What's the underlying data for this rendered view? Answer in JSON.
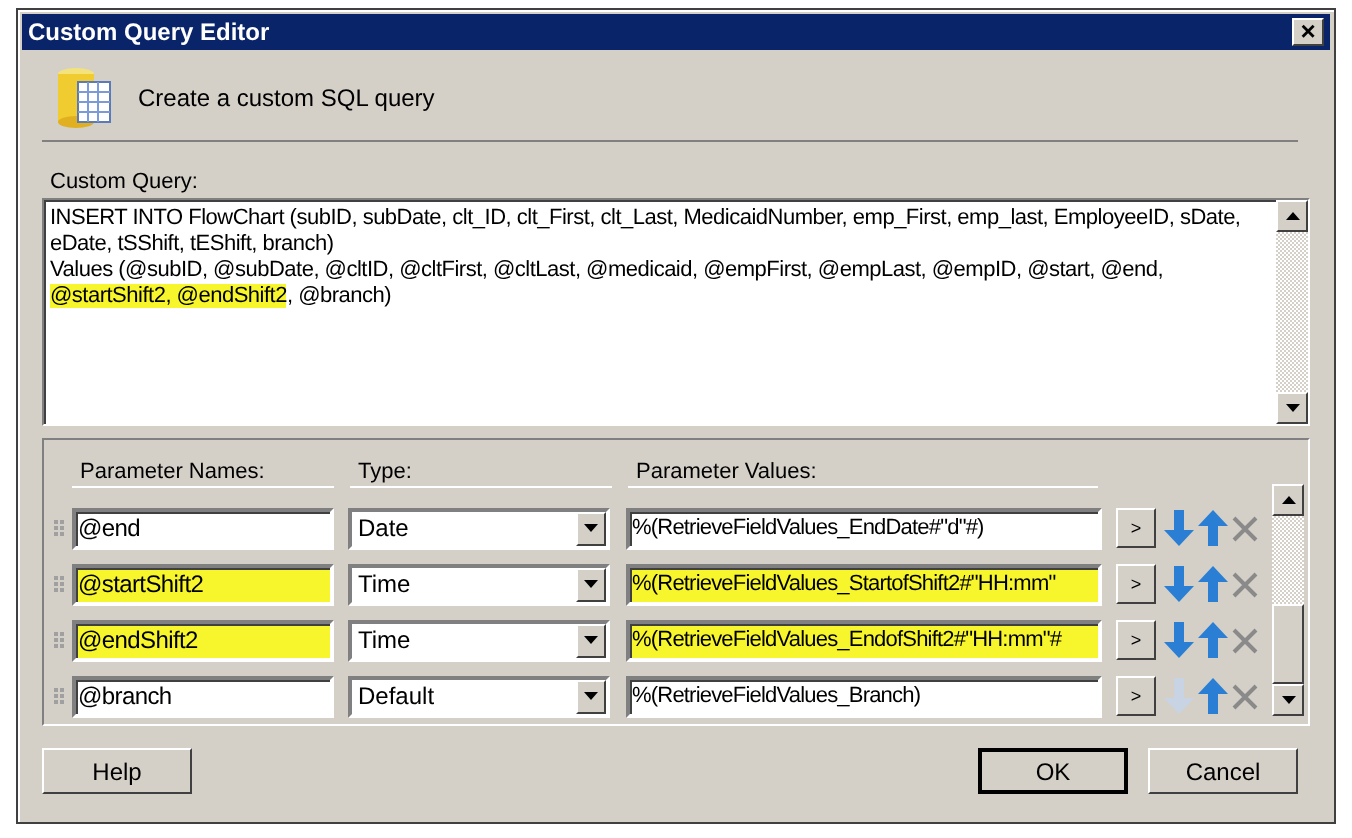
{
  "window": {
    "title": "Custom Query Editor",
    "close": "×"
  },
  "header": {
    "text": "Create a custom SQL query"
  },
  "query": {
    "label": "Custom Query:",
    "lines": [
      [
        {
          "text": "INSERT INTO FlowChart (subID, subDate, clt_ID, clt_First, clt_Last, MedicaidNumber, emp_First, emp_last, EmployeeID, sDate,",
          "highlighted": false
        }
      ],
      [
        {
          "text": "eDate, tSShift, tEShift, branch)",
          "highlighted": false
        }
      ],
      [
        {
          "text": "Values (@subID, @subDate, @cltID, @cltFirst, @cltLast, @medicaid, @empFirst, @empLast, @empID, @start, @end,",
          "highlighted": false
        }
      ],
      [
        {
          "text": "@startShift2, @endShift2",
          "highlighted": true
        },
        {
          "text": ", @branch)",
          "highlighted": false
        }
      ]
    ]
  },
  "parameters": {
    "columns": [
      "Parameter Names:",
      "Type:",
      "Parameter Values:"
    ],
    "browse": ">",
    "rows": [
      {
        "name": "@end",
        "type": "Date",
        "value": "%(RetrieveFieldValues_EndDate#\"d\"#)",
        "highlighted": false,
        "down_enabled": true
      },
      {
        "name": "@startShift2",
        "type": "Time",
        "value": "%(RetrieveFieldValues_StartofShift2#\"HH:mm\"",
        "highlighted": true,
        "down_enabled": true
      },
      {
        "name": "@endShift2",
        "type": "Time",
        "value": "%(RetrieveFieldValues_EndofShift2#\"HH:mm\"#",
        "highlighted": true,
        "down_enabled": true
      },
      {
        "name": "@branch",
        "type": "Default",
        "value": "%(RetrieveFieldValues_Branch)",
        "highlighted": false,
        "down_enabled": false
      }
    ]
  },
  "buttons": [
    {
      "label": "Help",
      "default": false
    },
    {
      "label": "OK",
      "default": true
    },
    {
      "label": "Cancel",
      "default": false
    }
  ]
}
